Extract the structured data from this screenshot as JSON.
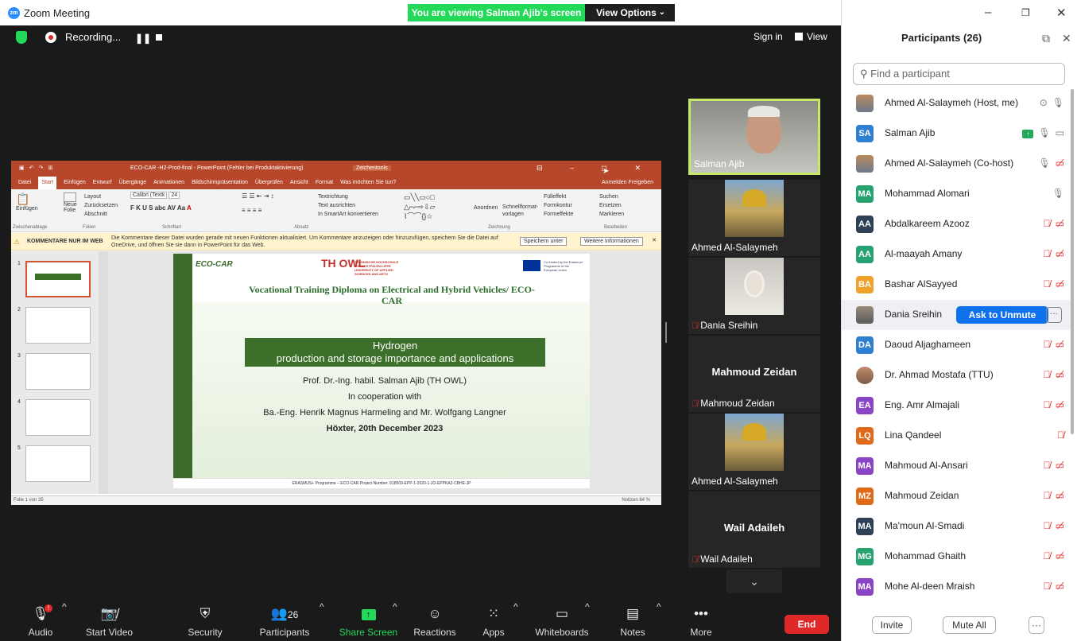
{
  "window": {
    "title": "Zoom Meeting"
  },
  "banner": {
    "viewing": "You are viewing Salman Ajib's screen",
    "view_options": "View Options"
  },
  "topbar": {
    "recording": "Recording...",
    "signin": "Sign in",
    "view": "View"
  },
  "ppt": {
    "window_title": "ECO-CAR -H2-Prod-final - PowerPoint (Fehler bei Produktaktivierung)",
    "context_tab": "Zeichentools",
    "menu": [
      "Datei",
      "Start",
      "Einfügen",
      "Entwurf",
      "Übergänge",
      "Animationen",
      "Bildschirmpräsentation",
      "Überprüfen",
      "Ansicht",
      "Format",
      "Was möchten Sie tun?"
    ],
    "menu_right": "Anmelden   Freigeben",
    "ribbon": {
      "paste": "Einfügen",
      "new_slide": "Neue Folie",
      "layout": "Layout",
      "reset": "Zurücksetzen",
      "section": "Abschnitt",
      "font": "Calibri (Textk",
      "size": "24",
      "text_dir": "Textrichtung",
      "align_text": "Text ausrichten",
      "smartart": "In SmartArt konvertieren",
      "arrange": "Anordnen",
      "quick_styles": "Schnellformat-vorlagen",
      "fill": "Fülleffekt",
      "outline": "Formkontur",
      "effects": "Formeffekte",
      "search": "Suchen",
      "replace": "Ersetzen",
      "select": "Markieren",
      "groups": [
        "Zwischenablage",
        "Folien",
        "Schriftart",
        "Absatz",
        "Zeichnung",
        "Bearbeiten"
      ]
    },
    "notice": {
      "label": "KOMMENTARE NUR IM WEB",
      "message": "Die Kommentare dieser Datei wurden gerade mit neuen Funktionen aktualisiert. Um Kommentare anzuzeigen oder hinzuzufügen, speichern Sie die Datei auf OneDrive, und öffnen Sie sie dann in PowerPoint für das Web.",
      "save_under": "Speichern unter",
      "more_info": "Weitere Informationen"
    },
    "thumbs": [
      "1",
      "2",
      "3",
      "4",
      "5"
    ],
    "slide": {
      "logo": "ECO-CAR",
      "th_owl": "TH OWL",
      "th_owl_sub": "TECHNISCHE HOCHSCHULE OSTWESTFALEN-LIPPE UNIVERSITY OF APPLIED SCIENCES AND ARTS",
      "eu_text": "Co-funded by the Erasmus+ Programme of the European Union",
      "title": "Vocational Training Diploma on Electrical and Hybrid Vehicles/ ECO-CAR",
      "band_line1": "Hydrogen",
      "band_line2": "production and storage importance and applications",
      "author": "Prof. Dr.-Ing. habil. Salman Ajib (TH OWL)",
      "coop": "In cooperation with",
      "coauthors": "Ba.-Eng. Henrik Magnus Harmeling and Mr. Wolfgang Langner",
      "place_date": "Höxter, 20th December 2023",
      "footer": "ERASMUS+ Programme – ECO-CAR Project Number: 618509-EPP-1-2020-1-JO-EPPKA2-CBHE-JP"
    },
    "status_left": "Folie 1 von 35",
    "status_right": "Notizen          64 %"
  },
  "videos": [
    {
      "name": "Salman Ajib"
    },
    {
      "name": "Ahmed Al-Salaymeh"
    },
    {
      "name": "Dania Sreihin"
    },
    {
      "name": "Mahmoud Zeidan",
      "center": "Mahmoud Zeidan"
    },
    {
      "name": "Ahmed Al-Salaymeh"
    },
    {
      "name": "Wail Adaileh",
      "center": "Wail Adaileh"
    }
  ],
  "toolbar": {
    "audio": "Audio",
    "start_video": "Start Video",
    "security": "Security",
    "participants": "Participants",
    "participants_count": "26",
    "share_screen": "Share Screen",
    "reactions": "Reactions",
    "apps": "Apps",
    "whiteboards": "Whiteboards",
    "notes": "Notes",
    "more": "More",
    "end": "End"
  },
  "panel": {
    "title": "Participants (26)",
    "search_placeholder": "Find a participant",
    "ask_to_unmute": "Ask to Unmute",
    "invite": "Invite",
    "mute_all": "Mute All",
    "participants": [
      {
        "initials": "",
        "name": "Ahmed Al-Salaymeh (Host, me)",
        "color": "#8a6a4a"
      },
      {
        "initials": "SA",
        "name": "Salman Ajib",
        "color": "#2f7fd1"
      },
      {
        "initials": "",
        "name": "Ahmed Al-Salaymeh (Co-host)",
        "color": "#8a6a4a"
      },
      {
        "initials": "MA",
        "name": "Mohammad Alomari",
        "color": "#27a372"
      },
      {
        "initials": "AA",
        "name": "Abdalkareem Azooz",
        "color": "#2d4257"
      },
      {
        "initials": "AA",
        "name": "Al-maayah Amany",
        "color": "#27a372"
      },
      {
        "initials": "BA",
        "name": "Bashar AlSayyed",
        "color": "#f0a12a"
      },
      {
        "initials": "",
        "name": "Dania Sreihin",
        "color": "#9a8a7a"
      },
      {
        "initials": "DA",
        "name": "Daoud Aljaghameen",
        "color": "#2f7fd1"
      },
      {
        "initials": "",
        "name": "Dr. Ahmad Mostafa (TTU)",
        "color": "#c08c6c"
      },
      {
        "initials": "EA",
        "name": "Eng. Amr Almajali",
        "color": "#8a44c6"
      },
      {
        "initials": "LQ",
        "name": "Lina Qandeel",
        "color": "#e06a1a"
      },
      {
        "initials": "MA",
        "name": "Mahmoud Al-Ansari",
        "color": "#8a44c6"
      },
      {
        "initials": "MZ",
        "name": "Mahmoud Zeidan",
        "color": "#e06a1a"
      },
      {
        "initials": "MA",
        "name": "Ma'moun Al-Smadi",
        "color": "#2d4257"
      },
      {
        "initials": "MG",
        "name": "Mohammad Ghaith",
        "color": "#27a372"
      },
      {
        "initials": "MA",
        "name": "Mohe Al-deen Mraish",
        "color": "#8a44c6"
      }
    ]
  },
  "colors": {
    "share_green": "#23d959",
    "end_red": "#e02828",
    "accent_blue": "#0e72ed",
    "ppt_red": "#b7472a"
  }
}
